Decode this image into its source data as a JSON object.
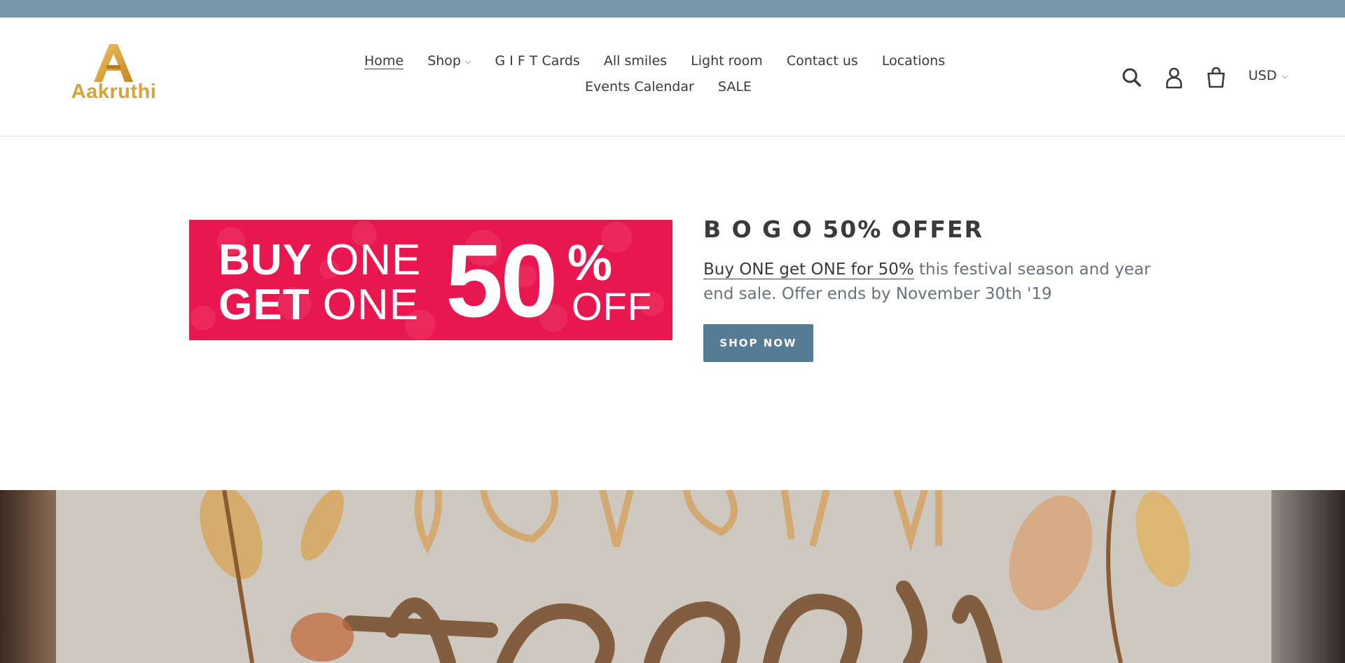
{
  "header": {
    "logo_text": "Aakruthi",
    "logo_colors": {
      "gold": "#d9a13a"
    },
    "nav": [
      {
        "label": "Home",
        "active": true
      },
      {
        "label": "Shop",
        "dropdown": true
      },
      {
        "label": "G I F T Cards"
      },
      {
        "label": "All smiles"
      },
      {
        "label": "Light room"
      },
      {
        "label": "Contact us"
      },
      {
        "label": "Locations"
      },
      {
        "label": "Events Calendar"
      },
      {
        "label": "SALE"
      }
    ],
    "icons": [
      "search-icon",
      "account-icon",
      "cart-icon"
    ],
    "currency": "USD"
  },
  "promo_image": {
    "line1_bold": "BUY",
    "line1_thin": "ONE",
    "line2_bold": "GET",
    "line2_thin": "ONE",
    "big_value": "50",
    "percent_sign": "%",
    "off_text": "OFF",
    "background": "#e8174f"
  },
  "feature": {
    "heading": "B O G O 50% OFFER",
    "body_link": "Buy ONE get ONE for 50%",
    "body_rest": " this festival season and year end sale. Offer ends by November 30th '19",
    "button_label": "SHOP NOW",
    "button_color": "#557b97"
  },
  "colors": {
    "announcement_bar": "#7796a8",
    "text": "#3a3a3a",
    "muted_text": "#69727b"
  }
}
